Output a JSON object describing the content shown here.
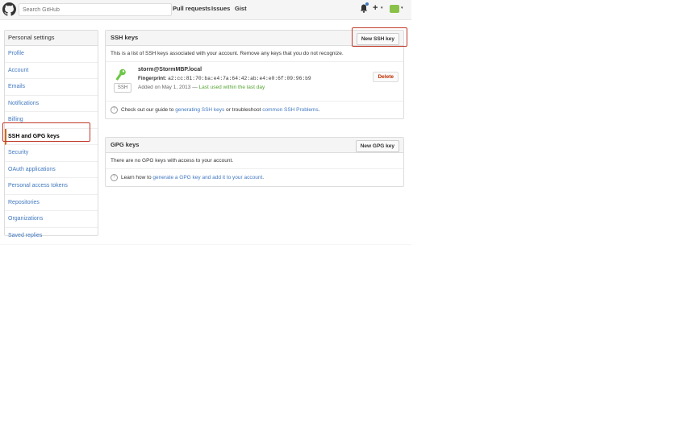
{
  "header": {
    "search_placeholder": "Search GitHub",
    "nav": [
      "Pull requests",
      "Issues",
      "Gist"
    ],
    "plus": "+",
    "caret": "▾"
  },
  "sidebar": {
    "title": "Personal settings",
    "items": [
      {
        "label": "Profile"
      },
      {
        "label": "Account"
      },
      {
        "label": "Emails"
      },
      {
        "label": "Notifications"
      },
      {
        "label": "Billing"
      },
      {
        "label": "SSH and GPG keys",
        "active": true
      },
      {
        "label": "Security"
      },
      {
        "label": "OAuth applications"
      },
      {
        "label": "Personal access tokens"
      },
      {
        "label": "Repositories"
      },
      {
        "label": "Organizations"
      },
      {
        "label": "Saved replies"
      }
    ]
  },
  "ssh": {
    "title": "SSH keys",
    "new_button": "New SSH key",
    "description": "This is a list of SSH keys associated with your account. Remove any keys that you do not recognize.",
    "key": {
      "title": "storm@StormMBP.local",
      "fingerprint_label": "Fingerprint:",
      "fingerprint": "a2:cc:81:70:ba:e4:7a:64:42:ab:e4:e0:6f:09:96:b9",
      "added": "Added on May 1, 2013 —",
      "last_used": "Last used within the last day",
      "badge": "SSH",
      "delete": "Delete"
    },
    "help_prefix": "Check out our guide to",
    "help_link1": "generating SSH keys",
    "help_mid": "or troubleshoot",
    "help_link2": "common SSH Problems",
    "help_suffix": "."
  },
  "gpg": {
    "title": "GPG keys",
    "new_button": "New GPG key",
    "empty": "There are no GPG keys with access to your account.",
    "help_prefix": "Learn how to",
    "help_link": "generate a GPG key and add it to your account",
    "help_suffix": "."
  },
  "colors": {
    "link": "#4078c0",
    "highlight": "#c0392b",
    "green": "#55a532",
    "danger": "#bd2c00"
  }
}
